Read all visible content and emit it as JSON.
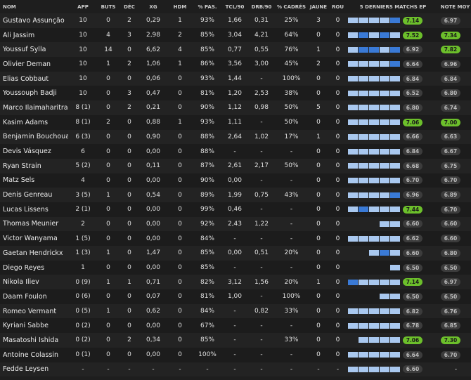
{
  "columns": [
    {
      "key": "name",
      "label": "NOM"
    },
    {
      "key": "app",
      "label": "APP"
    },
    {
      "key": "buts",
      "label": "BUTS"
    },
    {
      "key": "dec",
      "label": "DÉC"
    },
    {
      "key": "xg",
      "label": "XG"
    },
    {
      "key": "hdm",
      "label": "HDM"
    },
    {
      "key": "pas",
      "label": "% PAS."
    },
    {
      "key": "tcl",
      "label": "TCL/90"
    },
    {
      "key": "drb",
      "label": "DRB/90"
    },
    {
      "key": "cadres",
      "label": "% CADRÉS"
    },
    {
      "key": "jaune",
      "label": "JAUNE"
    },
    {
      "key": "rou",
      "label": "ROU"
    },
    {
      "key": "last5",
      "label": "5 DERNIERS MATCHS EP"
    },
    {
      "key": "avg",
      "label": "NOTE MOY"
    }
  ],
  "colors": {
    "bar_light": "#a9c8ef",
    "bar_dark": "#3a7ad6",
    "rating_green": "#6cbf2b",
    "rating_gray": "#3c3c3c"
  },
  "rows": [
    {
      "name": "Gustavo Assunção",
      "app": "10",
      "buts": "0",
      "dec": "2",
      "xg": "0,29",
      "hdm": "1",
      "pas": "93%",
      "tcl": "1,66",
      "drb": "0,31",
      "cadres": "25%",
      "jaune": "3",
      "rou": "0",
      "last5": [
        "l",
        "l",
        "l",
        "l",
        "d"
      ],
      "last_rating": "7.14",
      "last_green": true,
      "avg": "6.97",
      "avg_green": false
    },
    {
      "name": "Ali Jassim",
      "app": "10",
      "buts": "4",
      "dec": "3",
      "xg": "2,98",
      "hdm": "2",
      "pas": "85%",
      "tcl": "3,04",
      "drb": "4,21",
      "cadres": "64%",
      "jaune": "0",
      "rou": "0",
      "last5": [
        "l",
        "d",
        "l",
        "d",
        "l"
      ],
      "last_rating": "7.52",
      "last_green": true,
      "avg": "7.34",
      "avg_green": true
    },
    {
      "name": "Youssuf Sylla",
      "app": "10",
      "buts": "14",
      "dec": "0",
      "xg": "6,62",
      "hdm": "4",
      "pas": "85%",
      "tcl": "0,77",
      "drb": "0,55",
      "cadres": "76%",
      "jaune": "1",
      "rou": "0",
      "last5": [
        "l",
        "d",
        "d",
        "l",
        "d"
      ],
      "last_rating": "6.92",
      "last_green": false,
      "avg": "7.82",
      "avg_green": true
    },
    {
      "name": "Olivier Deman",
      "app": "10",
      "buts": "1",
      "dec": "2",
      "xg": "1,06",
      "hdm": "1",
      "pas": "86%",
      "tcl": "3,56",
      "drb": "3,00",
      "cadres": "45%",
      "jaune": "2",
      "rou": "0",
      "last5": [
        "l",
        "l",
        "l",
        "l",
        "d"
      ],
      "last_rating": "6.64",
      "last_green": false,
      "avg": "6.96",
      "avg_green": false
    },
    {
      "name": "Elias Cobbaut",
      "app": "10",
      "buts": "0",
      "dec": "0",
      "xg": "0,06",
      "hdm": "0",
      "pas": "93%",
      "tcl": "1,44",
      "drb": "-",
      "cadres": "100%",
      "jaune": "0",
      "rou": "0",
      "last5": [
        "l",
        "l",
        "l",
        "l",
        "l"
      ],
      "last_rating": "6.84",
      "last_green": false,
      "avg": "6.84",
      "avg_green": false
    },
    {
      "name": "Youssouph Badji",
      "app": "10",
      "buts": "0",
      "dec": "3",
      "xg": "0,47",
      "hdm": "0",
      "pas": "81%",
      "tcl": "1,20",
      "drb": "2,53",
      "cadres": "38%",
      "jaune": "0",
      "rou": "0",
      "last5": [
        "l",
        "l",
        "l",
        "l",
        "l"
      ],
      "last_rating": "6.52",
      "last_green": false,
      "avg": "6.80",
      "avg_green": false
    },
    {
      "name": "Marco Ilaimaharitra",
      "app": "8 (1)",
      "buts": "0",
      "dec": "2",
      "xg": "0,21",
      "hdm": "0",
      "pas": "90%",
      "tcl": "1,12",
      "drb": "0,98",
      "cadres": "50%",
      "jaune": "5",
      "rou": "0",
      "last5": [
        "l",
        "l",
        "l",
        "l",
        "l"
      ],
      "last_rating": "6.80",
      "last_green": false,
      "avg": "6.74",
      "avg_green": false
    },
    {
      "name": "Kasim Adams",
      "app": "8 (1)",
      "buts": "2",
      "dec": "0",
      "xg": "0,88",
      "hdm": "1",
      "pas": "93%",
      "tcl": "1,11",
      "drb": "-",
      "cadres": "50%",
      "jaune": "0",
      "rou": "0",
      "last5": [
        "l",
        "l",
        "l",
        "l",
        "l"
      ],
      "last_rating": "7.06",
      "last_green": true,
      "avg": "7.00",
      "avg_green": true
    },
    {
      "name": "Benjamin Bouchouari",
      "app": "6 (3)",
      "buts": "0",
      "dec": "0",
      "xg": "0,90",
      "hdm": "0",
      "pas": "88%",
      "tcl": "2,64",
      "drb": "1,02",
      "cadres": "17%",
      "jaune": "1",
      "rou": "0",
      "last5": [
        "l",
        "l",
        "l",
        "l",
        "l"
      ],
      "last_rating": "6.66",
      "last_green": false,
      "avg": "6.63",
      "avg_green": false
    },
    {
      "name": "Devis Vásquez",
      "app": "6",
      "buts": "0",
      "dec": "0",
      "xg": "0,00",
      "hdm": "0",
      "pas": "88%",
      "tcl": "-",
      "drb": "-",
      "cadres": "-",
      "jaune": "0",
      "rou": "0",
      "last5": [
        "l",
        "l",
        "l",
        "l",
        "l"
      ],
      "last_rating": "6.84",
      "last_green": false,
      "avg": "6.67",
      "avg_green": false
    },
    {
      "name": "Ryan Strain",
      "app": "5 (2)",
      "buts": "0",
      "dec": "0",
      "xg": "0,11",
      "hdm": "0",
      "pas": "87%",
      "tcl": "2,61",
      "drb": "2,17",
      "cadres": "50%",
      "jaune": "0",
      "rou": "0",
      "last5": [
        "l",
        "l",
        "l",
        "l",
        "l"
      ],
      "last_rating": "6.68",
      "last_green": false,
      "avg": "6.75",
      "avg_green": false
    },
    {
      "name": "Matz Sels",
      "app": "4",
      "buts": "0",
      "dec": "0",
      "xg": "0,00",
      "hdm": "0",
      "pas": "90%",
      "tcl": "0,00",
      "drb": "-",
      "cadres": "-",
      "jaune": "0",
      "rou": "0",
      "last5": [
        "l",
        "l",
        "l",
        "l",
        "l"
      ],
      "last_rating": "6.70",
      "last_green": false,
      "avg": "6.70",
      "avg_green": false
    },
    {
      "name": "Denis Genreau",
      "app": "3 (5)",
      "buts": "1",
      "dec": "0",
      "xg": "0,54",
      "hdm": "0",
      "pas": "89%",
      "tcl": "1,99",
      "drb": "0,75",
      "cadres": "43%",
      "jaune": "0",
      "rou": "0",
      "last5": [
        "l",
        "l",
        "l",
        "l",
        "d"
      ],
      "last_rating": "6.96",
      "last_green": false,
      "avg": "6.89",
      "avg_green": false
    },
    {
      "name": "Lucas Lissens",
      "app": "2 (1)",
      "buts": "0",
      "dec": "0",
      "xg": "0,00",
      "hdm": "0",
      "pas": "99%",
      "tcl": "0,46",
      "drb": "-",
      "cadres": "-",
      "jaune": "0",
      "rou": "0",
      "last5": [
        "l",
        "d",
        "l",
        "l",
        "l"
      ],
      "last_rating": "7.44",
      "last_green": true,
      "avg": "6.70",
      "avg_green": false
    },
    {
      "name": "Thomas Meunier",
      "app": "2",
      "buts": "0",
      "dec": "0",
      "xg": "0,00",
      "hdm": "0",
      "pas": "92%",
      "tcl": "2,43",
      "drb": "1,22",
      "cadres": "-",
      "jaune": "0",
      "rou": "0",
      "last5": [
        "",
        "",
        "",
        "l",
        "l"
      ],
      "last_rating": "6.60",
      "last_green": false,
      "avg": "6.60",
      "avg_green": false
    },
    {
      "name": "Victor Wanyama",
      "app": "1 (5)",
      "buts": "0",
      "dec": "0",
      "xg": "0,00",
      "hdm": "0",
      "pas": "84%",
      "tcl": "-",
      "drb": "-",
      "cadres": "-",
      "jaune": "0",
      "rou": "0",
      "last5": [
        "l",
        "l",
        "l",
        "l",
        "l"
      ],
      "last_rating": "6.62",
      "last_green": false,
      "avg": "6.60",
      "avg_green": false
    },
    {
      "name": "Gaetan Hendrickx",
      "app": "1 (3)",
      "buts": "1",
      "dec": "0",
      "xg": "1,47",
      "hdm": "0",
      "pas": "85%",
      "tcl": "0,00",
      "drb": "0,51",
      "cadres": "20%",
      "jaune": "0",
      "rou": "0",
      "last5": [
        "",
        "",
        "l",
        "d",
        "l"
      ],
      "last_rating": "6.60",
      "last_green": false,
      "avg": "6.80",
      "avg_green": false
    },
    {
      "name": "Diego Reyes",
      "app": "1",
      "buts": "0",
      "dec": "0",
      "xg": "0,00",
      "hdm": "0",
      "pas": "85%",
      "tcl": "-",
      "drb": "-",
      "cadres": "-",
      "jaune": "0",
      "rou": "0",
      "last5": [
        "",
        "",
        "",
        "",
        "l"
      ],
      "last_rating": "6.50",
      "last_green": false,
      "avg": "6.50",
      "avg_green": false
    },
    {
      "name": "Nikola Iliev",
      "app": "0 (9)",
      "buts": "1",
      "dec": "1",
      "xg": "0,71",
      "hdm": "0",
      "pas": "82%",
      "tcl": "3,12",
      "drb": "1,56",
      "cadres": "20%",
      "jaune": "1",
      "rou": "0",
      "last5": [
        "d",
        "l",
        "l",
        "l",
        "l"
      ],
      "last_rating": "7.14",
      "last_green": true,
      "avg": "6.97",
      "avg_green": false
    },
    {
      "name": "Daam Foulon",
      "app": "0 (6)",
      "buts": "0",
      "dec": "0",
      "xg": "0,07",
      "hdm": "0",
      "pas": "81%",
      "tcl": "1,00",
      "drb": "-",
      "cadres": "100%",
      "jaune": "0",
      "rou": "0",
      "last5": [
        "",
        "",
        "",
        "l",
        "l"
      ],
      "last_rating": "6.50",
      "last_green": false,
      "avg": "6.50",
      "avg_green": false
    },
    {
      "name": "Romeo Vermant",
      "app": "0 (5)",
      "buts": "1",
      "dec": "0",
      "xg": "0,62",
      "hdm": "0",
      "pas": "84%",
      "tcl": "-",
      "drb": "0,82",
      "cadres": "33%",
      "jaune": "0",
      "rou": "0",
      "last5": [
        "l",
        "l",
        "l",
        "l",
        "l"
      ],
      "last_rating": "6.82",
      "last_green": false,
      "avg": "6.76",
      "avg_green": false
    },
    {
      "name": "Kyriani Sabbe",
      "app": "0 (2)",
      "buts": "0",
      "dec": "0",
      "xg": "0,00",
      "hdm": "0",
      "pas": "67%",
      "tcl": "-",
      "drb": "-",
      "cadres": "-",
      "jaune": "0",
      "rou": "0",
      "last5": [
        "l",
        "l",
        "l",
        "l",
        "l"
      ],
      "last_rating": "6.78",
      "last_green": false,
      "avg": "6.85",
      "avg_green": false
    },
    {
      "name": "Masatoshi Ishida",
      "app": "0 (2)",
      "buts": "0",
      "dec": "2",
      "xg": "0,34",
      "hdm": "0",
      "pas": "85%",
      "tcl": "-",
      "drb": "-",
      "cadres": "33%",
      "jaune": "0",
      "rou": "0",
      "last5": [
        "",
        "l",
        "l",
        "l",
        "l"
      ],
      "last_rating": "7.06",
      "last_green": true,
      "avg": "7.30",
      "avg_green": true
    },
    {
      "name": "Antoine Colassin",
      "app": "0 (1)",
      "buts": "0",
      "dec": "0",
      "xg": "0,00",
      "hdm": "0",
      "pas": "100%",
      "tcl": "-",
      "drb": "-",
      "cadres": "-",
      "jaune": "0",
      "rou": "0",
      "last5": [
        "l",
        "l",
        "l",
        "l",
        "l"
      ],
      "last_rating": "6.64",
      "last_green": false,
      "avg": "6.70",
      "avg_green": false
    },
    {
      "name": "Fedde Leysen",
      "app": "-",
      "buts": "-",
      "dec": "-",
      "xg": "-",
      "hdm": "-",
      "pas": "-",
      "tcl": "-",
      "drb": "-",
      "cadres": "-",
      "jaune": "-",
      "rou": "-",
      "last5": [
        "l",
        "l",
        "l",
        "l",
        "l"
      ],
      "last_rating": "6.60",
      "last_green": false,
      "avg": "-",
      "avg_green": false
    }
  ]
}
